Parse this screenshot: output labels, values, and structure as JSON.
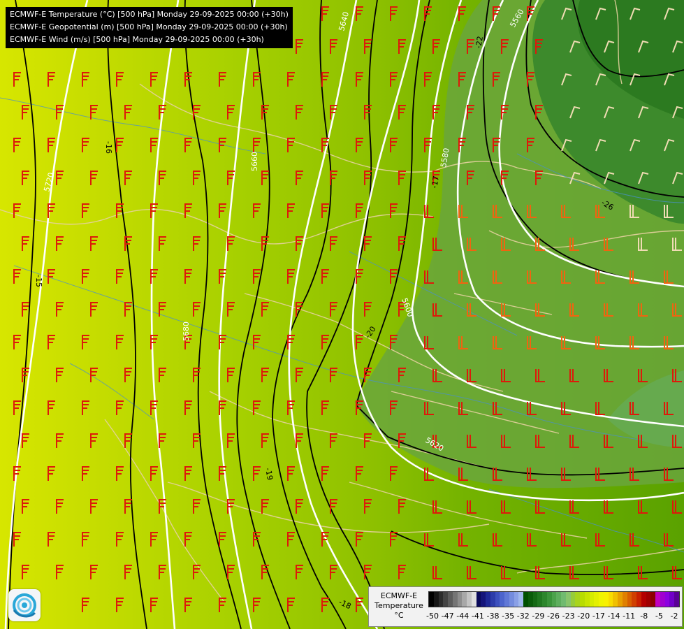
{
  "titles": [
    "ECMWF-E Temperature (°C) [500 hPa] Monday 29-09-2025 00:00 (+30h)",
    "ECMWF-E Geopotential (m) [500 hPa] Monday 29-09-2025 00:00 (+30h)",
    "ECMWF-E Wind (m/s) [500 hPa] Monday 29-09-2025 00:00 (+30h)"
  ],
  "geopotential_labels": [
    "5720",
    "5680",
    "5660",
    "5640",
    "5600",
    "5580",
    "5560",
    "5620"
  ],
  "temperature_labels": [
    "-16",
    "-15",
    "-17",
    "-20",
    "-22",
    "-26",
    "-19",
    "-18"
  ],
  "legend": {
    "title_line1": "ECMWF-E",
    "title_line2": "Temperature",
    "unit": "°C",
    "ticks": [
      "-50",
      "-47",
      "-44",
      "-41",
      "-38",
      "-35",
      "-32",
      "-29",
      "-26",
      "-23",
      "-20",
      "-17",
      "-14",
      "-11",
      "-8",
      "-5",
      "-2"
    ],
    "colors": [
      "#000000",
      "#161616",
      "#2c2c2c",
      "#444444",
      "#5c5c5c",
      "#757575",
      "#8e8e8e",
      "#a8a8a8",
      "#c4c4c4",
      "#e0e0e0",
      "#0a0a5a",
      "#14147a",
      "#1e2896",
      "#2c3caa",
      "#3c50be",
      "#4c64cc",
      "#6078d6",
      "#748cde",
      "#8aa0e6",
      "#a0b8ee",
      "#005000",
      "#0a5c0a",
      "#156a15",
      "#207820",
      "#2c862c",
      "#3a943a",
      "#4ca24c",
      "#5eae5e",
      "#70ba70",
      "#88c46c",
      "#96cc3a",
      "#a8d41c",
      "#b8dc00",
      "#c8e400",
      "#d6ec00",
      "#e4f000",
      "#f0f400",
      "#f8f000",
      "#f8dc00",
      "#f0c000",
      "#e8a000",
      "#e08000",
      "#d86000",
      "#d04000",
      "#c82000",
      "#b40000",
      "#a00000",
      "#8c0000",
      "#c000c0",
      "#a000d0",
      "#8c00e0",
      "#7000c8",
      "#5a0096"
    ],
    "accent_colors": {
      "background": "#8cc400",
      "wind_barb_red": "#dd1a0a",
      "wind_barb_orange": "#f06410",
      "wind_barb_pale": "#f0dcb4",
      "geopotential_contour": "#ffffff",
      "temperature_contour": "#000000",
      "border_line": "#e6d2a0"
    }
  }
}
